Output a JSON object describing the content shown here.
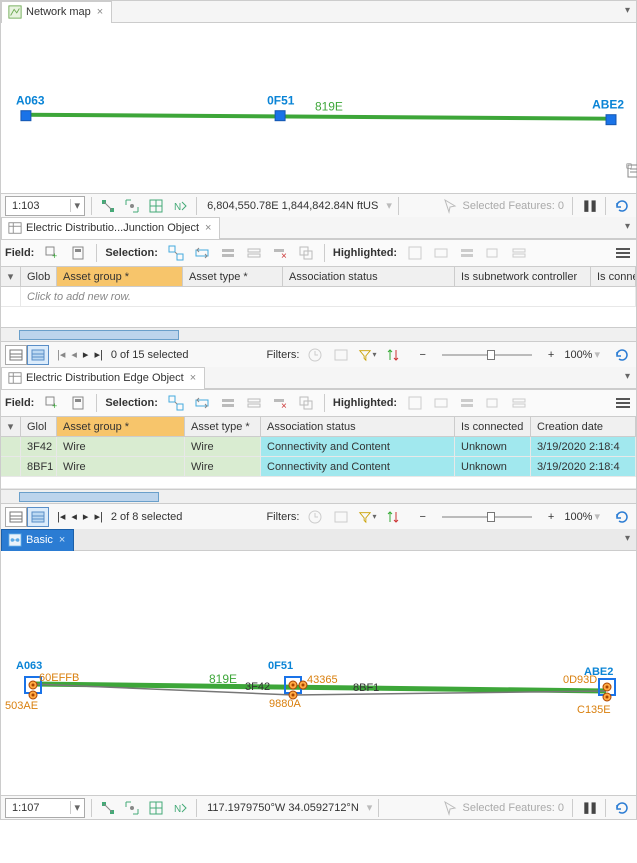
{
  "tabs": {
    "map": "Network map",
    "junction": "Electric Distributio...Junction Object",
    "edge": "Electric Distribution Edge Object",
    "basic": "Basic"
  },
  "map1": {
    "scale": "1:103",
    "coords": "6,804,550.78E 1,844,842.84N ftUS",
    "selectedFeatures": "Selected Features: 0",
    "nodes": [
      "A063",
      "0F51",
      "ABE2"
    ],
    "edgeLabel": "819E"
  },
  "field_labels": {
    "field": "Field:",
    "selection": "Selection:",
    "highlighted": "Highlighted:"
  },
  "junction_table": {
    "columns": [
      "",
      "Glob",
      "Asset group *",
      "Asset type *",
      "Association status",
      "Is subnetwork controller",
      "Is connect"
    ],
    "addRow": "Click to add new row.",
    "footer": {
      "sel": "0 of 15 selected",
      "filters": "Filters:",
      "zoom": "100%"
    }
  },
  "edge_table": {
    "columns": [
      "",
      "Glol",
      "Asset group *",
      "Asset type *",
      "Association status",
      "Is connected",
      "Creation date"
    ],
    "rows": [
      {
        "id": "3F42",
        "ag": "Wire",
        "at": "Wire",
        "assoc": "Connectivity and Content",
        "conn": "Unknown",
        "date": "3/19/2020 2:18:4"
      },
      {
        "id": "8BF1",
        "ag": "Wire",
        "at": "Wire",
        "assoc": "Connectivity and Content",
        "conn": "Unknown",
        "date": "3/19/2020 2:18:4"
      }
    ],
    "footer": {
      "sel": "2 of 8 selected",
      "filters": "Filters:",
      "zoom": "100%"
    }
  },
  "map2": {
    "scale": "1:107",
    "coords": "117.1979750°W 34.0592712°N",
    "selectedFeatures": "Selected Features: 0",
    "junctions": [
      "A063",
      "0F51",
      "ABE2"
    ],
    "subJLeft": "503AE",
    "subJL2": "60EFFB",
    "subJMid": "9880A",
    "subJMid2": "43365",
    "subJRight": "C135E",
    "subJR2": "0D93D",
    "edges": {
      "main": "819E",
      "e1": "3F42",
      "e2": "8BF1"
    }
  }
}
